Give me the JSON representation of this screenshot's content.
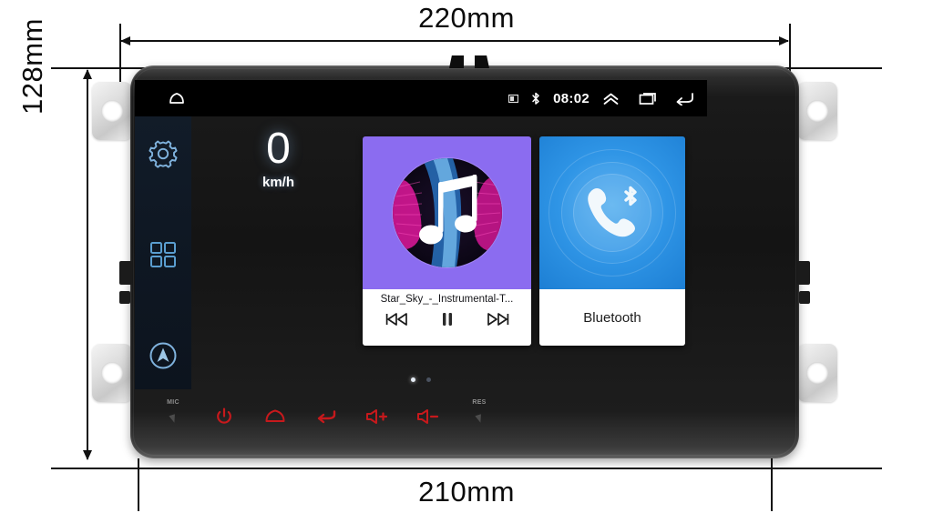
{
  "diagram": {
    "type": "product-dimension-drawing",
    "subject": "car android head unit / 2-din radio faceplate",
    "dimensions": {
      "top_width": "220mm",
      "left_height": "128mm",
      "bottom_width": "210mm"
    }
  },
  "device": {
    "brackets": [
      "mount-bracket-top-left",
      "mount-bracket-bottom-left",
      "mount-bracket-top-right",
      "mount-bracket-bottom-right"
    ]
  },
  "screen": {
    "statusbar": {
      "home_icon": "home-icon",
      "signal_icon": "signal-icon",
      "bluetooth_icon": "bluetooth-icon",
      "clock": "08:02",
      "expand_icon": "double-chevron-up-icon",
      "recents_icon": "recent-apps-icon",
      "back_icon": "back-arrow-icon"
    },
    "dock": {
      "settings_icon": "gear-icon",
      "apps_icon": "apps-grid-icon",
      "navigation_icon": "navigation-compass-icon"
    },
    "speedometer": {
      "value": "0",
      "unit": "km/h"
    },
    "widgets": {
      "music": {
        "art_icon": "music-note-icon",
        "title": "Star_Sky_-_Instrumental-T...",
        "prev_icon": "previous-track-icon",
        "pause_icon": "pause-icon",
        "next_icon": "next-track-icon",
        "art_bg": "#8b6cf0"
      },
      "bluetooth": {
        "art_icon": "bluetooth-phone-icon",
        "label": "Bluetooth",
        "art_bg": "#2f95e6"
      }
    },
    "page_dots": {
      "count": 2,
      "active_index": 0
    }
  },
  "keybar": {
    "keys": [
      {
        "name": "mic-key",
        "tag": "MIC",
        "icon": "microphone-hole-icon",
        "color": "#8e8e8e"
      },
      {
        "name": "power-key",
        "tag": "",
        "icon": "power-icon",
        "color": "#c6191c"
      },
      {
        "name": "home-key",
        "tag": "",
        "icon": "home-icon",
        "color": "#c6191c"
      },
      {
        "name": "back-key",
        "tag": "",
        "icon": "back-arrow-icon",
        "color": "#c6191c"
      },
      {
        "name": "volume-up-key",
        "tag": "",
        "icon": "volume-up-icon",
        "color": "#c6191c"
      },
      {
        "name": "volume-down-key",
        "tag": "",
        "icon": "volume-down-icon",
        "color": "#c6191c"
      },
      {
        "name": "reset-key",
        "tag": "RES",
        "icon": "reset-pinhole-icon",
        "color": "#8e8e8e"
      }
    ]
  },
  "colors": {
    "accent_red": "#c6191c",
    "dock_icon_blue": "#6aa9d8",
    "bt_blue": "#2f95e6",
    "music_purple": "#8b6cf0",
    "ink": "#111111"
  }
}
